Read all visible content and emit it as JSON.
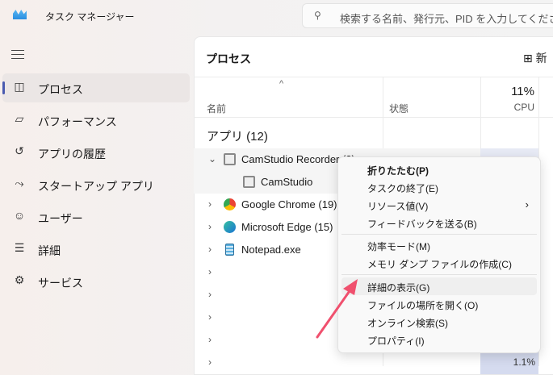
{
  "app": {
    "title": "タスク マネージャー",
    "search_placeholder": "検索する名前、発行元、PID を入力してください"
  },
  "sidebar": {
    "items": [
      {
        "label": "プロセス",
        "icon": "processes-icon",
        "selected": true
      },
      {
        "label": "パフォーマンス",
        "icon": "performance-icon"
      },
      {
        "label": "アプリの履歴",
        "icon": "history-icon"
      },
      {
        "label": "スタートアップ アプリ",
        "icon": "startup-icon"
      },
      {
        "label": "ユーザー",
        "icon": "users-icon"
      },
      {
        "label": "詳細",
        "icon": "details-icon"
      },
      {
        "label": "サービス",
        "icon": "services-icon"
      }
    ]
  },
  "main": {
    "title": "プロセス",
    "new_task_label": "新",
    "columns": {
      "name": "名前",
      "status": "状態",
      "cpu": "CPU",
      "cpu_total": "11%"
    },
    "group": "アプリ (12)",
    "rows": [
      {
        "name": "CamStudio Recorder (3)",
        "expanded": true,
        "cpu": ""
      },
      {
        "name": "CamStudio",
        "child": true,
        "cpu": ""
      },
      {
        "name": "Google Chrome (19)",
        "cpu": ""
      },
      {
        "name": "Microsoft Edge (15)",
        "cpu": ""
      },
      {
        "name": "Notepad.exe",
        "cpu": ""
      },
      {
        "name": "",
        "cpu": ""
      },
      {
        "name": "",
        "cpu": ""
      },
      {
        "name": "",
        "cpu": ""
      },
      {
        "name": "",
        "cpu": ""
      },
      {
        "name": "",
        "cpu": "1.1%"
      }
    ]
  },
  "context_menu": {
    "items": [
      "折りたたむ(P)",
      "タスクの終了(E)",
      "リソース値(V)",
      "フィードバックを送る(B)",
      "効率モード(M)",
      "メモリ ダンプ ファイルの作成(C)",
      "詳細の表示(G)",
      "ファイルの場所を開く(O)",
      "オンライン検索(S)",
      "プロパティ(I)"
    ],
    "highlighted": "詳細の表示(G)"
  },
  "colors": {
    "accent": "#4a5bb0",
    "cpu_heat": "#d5dbef",
    "arrow": "#f0506e"
  }
}
